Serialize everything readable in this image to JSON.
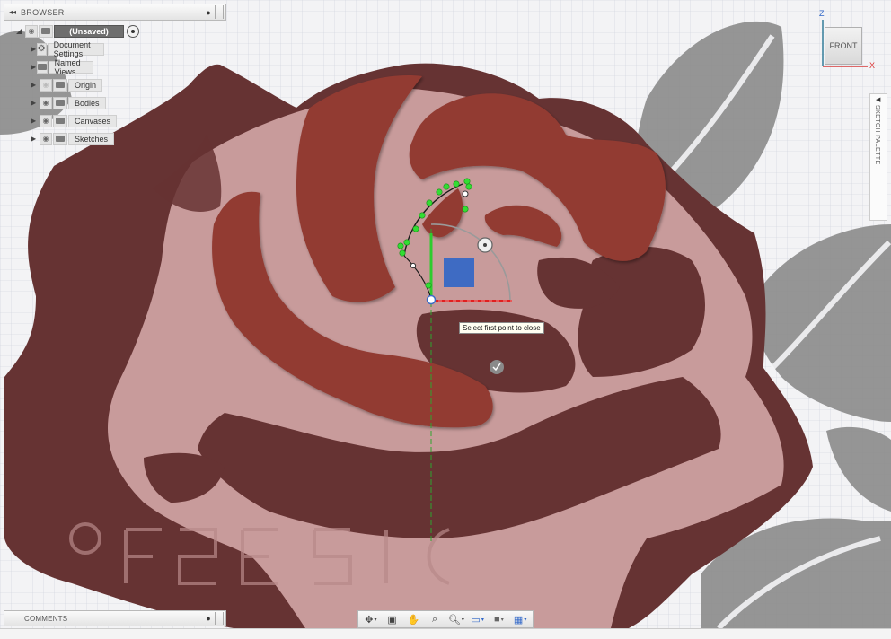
{
  "browser": {
    "title": "BROWSER",
    "tree": [
      {
        "label": "(Unsaved)",
        "kind": "root"
      },
      {
        "label": "Document Settings",
        "kind": "settings"
      },
      {
        "label": "Named Views",
        "kind": "folder"
      },
      {
        "label": "Origin",
        "kind": "folder-eye"
      },
      {
        "label": "Bodies",
        "kind": "folder-eye"
      },
      {
        "label": "Canvases",
        "kind": "folder-eye"
      },
      {
        "label": "Sketches",
        "kind": "folder-eye"
      }
    ]
  },
  "viewcube": {
    "face": "FRONT",
    "axis_z": "Z",
    "axis_x": "X"
  },
  "sketch_palette": {
    "label": "SKETCH PALETTE"
  },
  "tooltip": {
    "text": "Select first point to close"
  },
  "comments": {
    "title": "COMMENTS"
  },
  "toolbar": {
    "icons": [
      "orbit-icon",
      "look-at-icon",
      "pan-icon",
      "zoom-window-icon",
      "zoom-icon",
      "display-settings-icon",
      "visual-style-icon",
      "grid-settings-icon"
    ]
  },
  "colors": {
    "canvas_bg": "#f3f3f5",
    "grid": "#c9ccd6",
    "rose_dark": "#643232",
    "rose_light": "#c89999",
    "petal_red": "#913b32",
    "leaf_gray": "#8a8a8a",
    "sketch_green": "#33cc33",
    "sketch_red": "#e02020",
    "sketch_blue": "#3060c0"
  }
}
